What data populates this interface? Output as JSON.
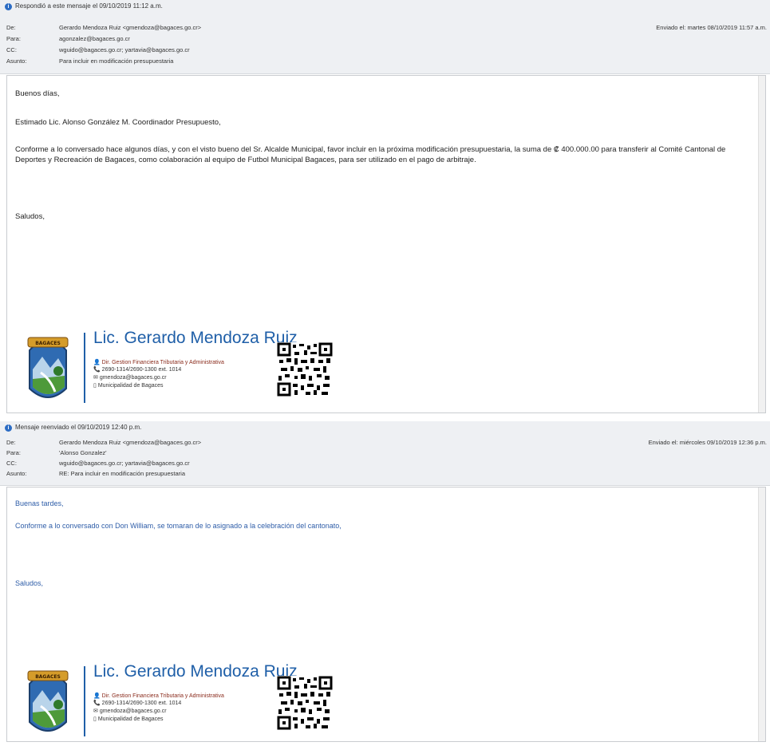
{
  "message1": {
    "info": "Respondió a este mensaje el 09/10/2019 11:12 a.m.",
    "fields": [
      {
        "label": "De:",
        "value": "Gerardo Mendoza Ruiz <gmendoza@bagaces.go.cr>"
      },
      {
        "label": "Para:",
        "value": "agonzalez@bagaces.go.cr"
      },
      {
        "label": "CC:",
        "value": "wguido@bagaces.go.cr; yartavia@bagaces.go.cr"
      },
      {
        "label": "Asunto:",
        "value": "Para incluir en modificación presupuestaria"
      }
    ],
    "sent_label": "Enviado el:",
    "sent_value": "martes 08/10/2019 11:57 a.m.",
    "greeting": "Buenos días,",
    "salutation": "Estimado Lic. Alonso González M. Coordinador Presupuesto,",
    "body": "Conforme a lo conversado hace algunos días, y con el visto bueno  del Sr. Alcalde Municipal, favor incluir en la próxima modificación presupuestaria, la suma de ₡ 400.000.00 para transferir al Comité Cantonal de Deportes y Recreación de Bagaces, como colaboración al equipo de Futbol Municipal Bagaces, para ser utilizado en el pago de arbitraje.",
    "closing": "Saludos,"
  },
  "message2": {
    "info": "Mensaje reenviado el 09/10/2019 12:40 p.m.",
    "fields": [
      {
        "label": "De:",
        "value": "Gerardo Mendoza Ruiz <gmendoza@bagaces.go.cr>"
      },
      {
        "label": "Para:",
        "value": "'Alonso Gonzalez'"
      },
      {
        "label": "CC:",
        "value": "wguido@bagaces.go.cr; yartavia@bagaces.go.cr"
      },
      {
        "label": "Asunto:",
        "value": "RE: Para incluir en modificación presupuestaria"
      }
    ],
    "sent_label": "Enviado el:",
    "sent_value": "miércoles 09/10/2019 12:36 p.m.",
    "greeting": "Buenas tardes,",
    "body": "Conforme a lo conversado con Don William, se tomaran de lo asignado a la celebración del cantonato,",
    "closing": "Saludos,"
  },
  "signature": {
    "name": "Lic. Gerardo Mendoza Ruiz",
    "title": "Dir. Gestion Financiera Tributaria y Administrativa",
    "phone": "2690-1314/2690-1300 ext. 1014",
    "email": "gmendoza@bagaces.go.cr",
    "org": "Municipalidad de Bagaces",
    "crest_text": "BAGACES"
  },
  "colors": {
    "accent": "#1f5fa8",
    "info_icon": "#2b6cc4",
    "header_bg": "#eef0f3",
    "reply_text": "#2e5da8"
  }
}
